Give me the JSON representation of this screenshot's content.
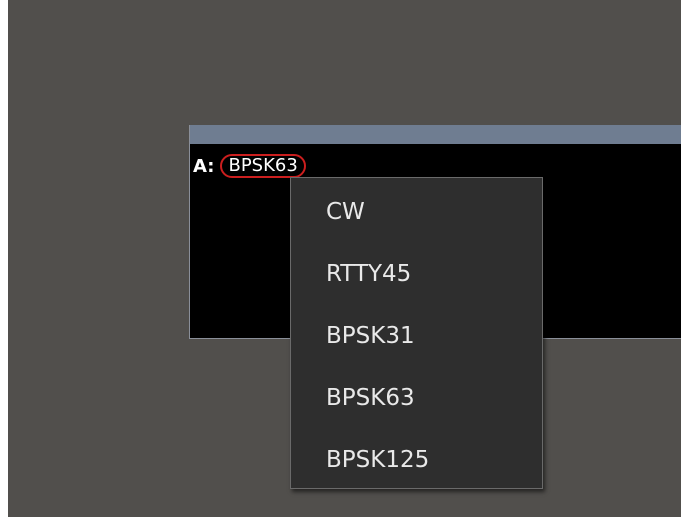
{
  "panel": {
    "mode_prefix": "A:",
    "selected_mode": "BPSK63"
  },
  "dropdown": {
    "items": [
      {
        "label": "CW"
      },
      {
        "label": "RTTY45"
      },
      {
        "label": "BPSK31"
      },
      {
        "label": "BPSK63"
      },
      {
        "label": "BPSK125"
      }
    ]
  },
  "colors": {
    "background": "#514f4c",
    "panel": "#000000",
    "titlebar": "#6f7d91",
    "highlight_border": "#cc1e1e",
    "menu_bg": "#2e2e2e",
    "menu_text": "#e9e9e9"
  }
}
